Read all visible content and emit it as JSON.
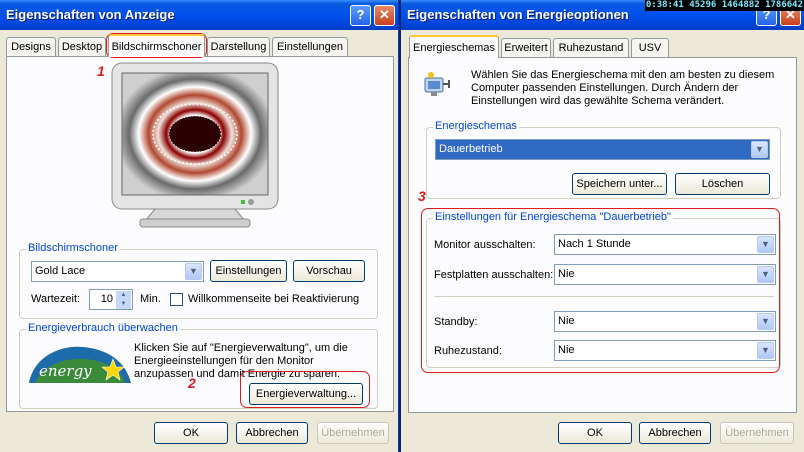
{
  "display_window": {
    "title": "Eigenschaften von Anzeige",
    "help_label": "?",
    "close_label": "✕",
    "tabs": [
      "Designs",
      "Desktop",
      "Bildschirmschoner",
      "Darstellung",
      "Einstellungen"
    ],
    "screensaver": {
      "group_label": "Bildschirmschoner",
      "selected": "Gold Lace",
      "settings_button": "Einstellungen",
      "preview_button": "Vorschau",
      "wait_label": "Wartezeit:",
      "wait_value": "10",
      "wait_unit": "Min.",
      "welcome_label": "Willkommenseite bei Reaktivierung"
    },
    "energy": {
      "group_label": "Energieverbrauch überwachen",
      "description": "Klicken Sie auf \"Energieverwaltung\", um die Energieeinstellungen für den Monitor anzupassen und damit Energie zu sparen.",
      "button": "Energieverwaltung...",
      "logo_text": "energy"
    },
    "footer": {
      "ok": "OK",
      "cancel": "Abbrechen",
      "apply": "Übernehmen"
    }
  },
  "power_window": {
    "title": "Eigenschaften von Energieoptionen",
    "timestamp": "0:38:41 45296 1464882 1786642",
    "help_label": "?",
    "close_label": "✕",
    "tabs": [
      "Energieschemas",
      "Erweitert",
      "Ruhezustand",
      "USV"
    ],
    "intro": "Wählen Sie das Energieschema mit den am besten zu diesem Computer passenden Einstellungen. Durch Ändern der Einstellungen wird das gewählte Schema verändert.",
    "schemes": {
      "group_label": "Energieschemas",
      "selected": "Dauerbetrieb",
      "save_button": "Speichern unter...",
      "delete_button": "Löschen"
    },
    "settings": {
      "group_label": "Einstellungen für Energieschema \"Dauerbetrieb\"",
      "rows": [
        {
          "label": "Monitor ausschalten:",
          "value": "Nach 1 Stunde"
        },
        {
          "label": "Festplatten ausschalten:",
          "value": "Nie"
        },
        {
          "label": "Standby:",
          "value": "Nie"
        },
        {
          "label": "Ruhezustand:",
          "value": "Nie"
        }
      ]
    },
    "footer": {
      "ok": "OK",
      "cancel": "Abbrechen",
      "apply": "Übernehmen"
    }
  },
  "annotations": [
    "1",
    "2",
    "3"
  ],
  "colors": {
    "titlebar": "#0050ee",
    "dialog_bg": "#ece9d8",
    "annotation": "#e01b1b",
    "group_label": "#0046d5",
    "selection": "#316ac5"
  }
}
